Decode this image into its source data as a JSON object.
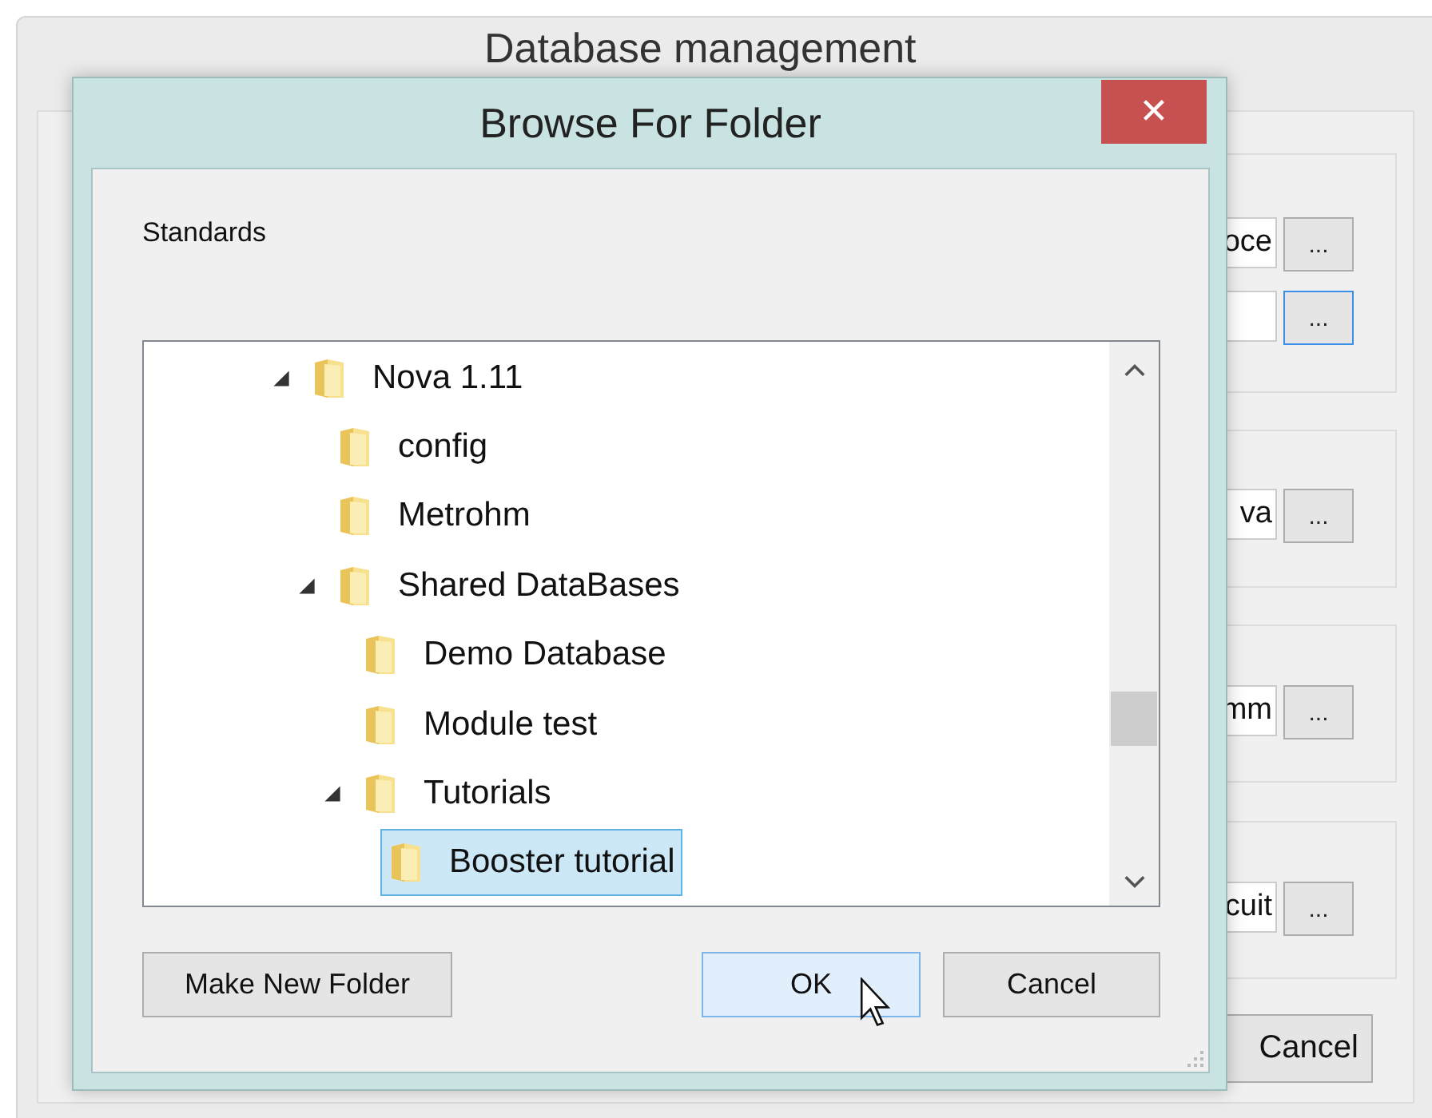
{
  "background_window": {
    "title": "Database management",
    "fields": [
      {
        "value": "oce",
        "focused": false
      },
      {
        "focused": true
      },
      {
        "value": "va",
        "focused": false
      },
      {
        "value": "mm",
        "focused": false
      },
      {
        "value": "cuit",
        "focused": false
      }
    ],
    "browse_button": "...",
    "cancel_button": "Cancel"
  },
  "dialog": {
    "title": "Browse For Folder",
    "close": "✕",
    "description": "Standards",
    "tree": [
      {
        "label": "Nova 1.11",
        "expanded": true,
        "selected": false,
        "children": [
          {
            "label": "config",
            "selected": false
          },
          {
            "label": "Metrohm",
            "selected": false
          },
          {
            "label": "Shared DataBases",
            "expanded": true,
            "selected": false,
            "children": [
              {
                "label": "Demo Database",
                "selected": false
              },
              {
                "label": "Module test",
                "selected": false
              },
              {
                "label": "Tutorials",
                "expanded": true,
                "selected": false,
                "children": [
                  {
                    "label": "Booster tutorial",
                    "selected": true
                  }
                ]
              }
            ]
          }
        ]
      }
    ],
    "buttons": [
      {
        "label": "Make New Folder",
        "hovered": false
      },
      {
        "label": "OK",
        "hovered": true
      },
      {
        "label": "Cancel",
        "hovered": false
      }
    ]
  }
}
